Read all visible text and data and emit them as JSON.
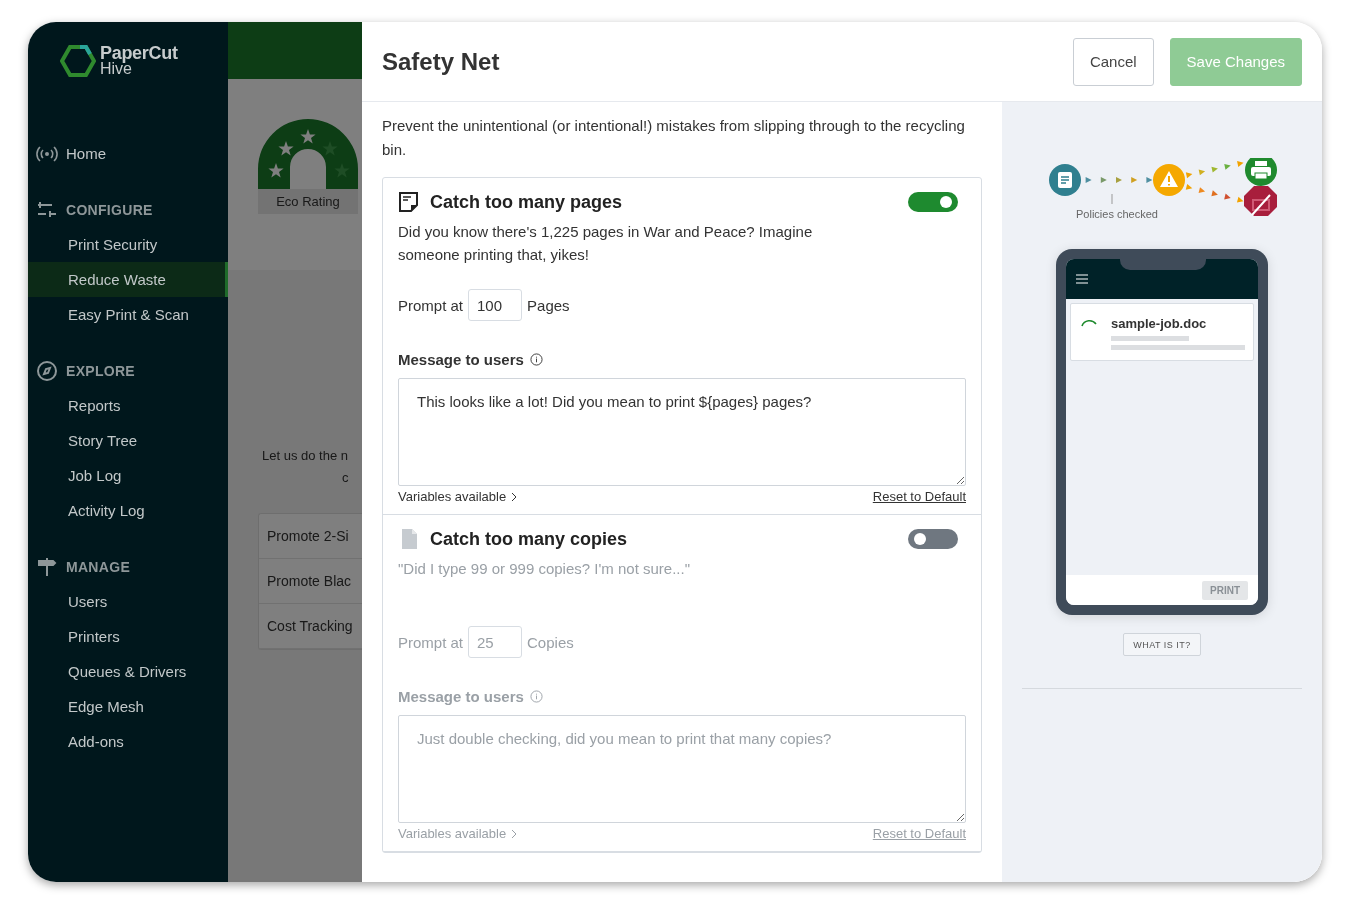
{
  "sidebar": {
    "logo": {
      "brand": "PaperCut",
      "product": "Hive"
    },
    "home": {
      "label": "Home",
      "selected": false
    },
    "sections": [
      {
        "label": "CONFIGURE",
        "items": [
          {
            "label": "Print Security",
            "selected": false
          },
          {
            "label": "Reduce Waste",
            "selected": true
          },
          {
            "label": "Easy Print & Scan",
            "selected": false
          }
        ]
      },
      {
        "label": "EXPLORE",
        "items": [
          {
            "label": "Reports",
            "selected": false
          },
          {
            "label": "Story Tree",
            "selected": false
          },
          {
            "label": "Job Log",
            "selected": false
          },
          {
            "label": "Activity Log",
            "selected": false
          }
        ]
      },
      {
        "label": "MANAGE",
        "items": [
          {
            "label": "Users",
            "selected": false
          },
          {
            "label": "Printers",
            "selected": false
          },
          {
            "label": "Queues & Drivers",
            "selected": false
          },
          {
            "label": "Edge Mesh",
            "selected": false
          },
          {
            "label": "Add-ons",
            "selected": false
          }
        ]
      }
    ]
  },
  "background_page": {
    "badge_label": "Eco Rating",
    "intro_lines": [
      "Let us do the n",
      "c"
    ],
    "list": [
      "Promote 2-Si",
      "Promote Blac",
      "Cost Tracking"
    ]
  },
  "drawer": {
    "title": "Safety Net",
    "buttons": [
      {
        "kind": "secondary",
        "label": "Cancel"
      },
      {
        "kind": "primary",
        "label": "Save Changes",
        "disabled": true
      }
    ],
    "intro": "Prevent the unintentional (or intentional!) mistakes from slipping through to the recycling bin.",
    "policies": [
      {
        "kind": "pages",
        "title": "Catch too many pages",
        "enabled": true,
        "description": "Did you know there's 1,225 pages in War and Peace? Imagine someone printing that, yikes!",
        "prompt_label": "Prompt at",
        "value": "100",
        "unit": "Pages",
        "message_label": "Message to users",
        "message": "This looks like a lot! Did you mean to print ${pages} pages?",
        "variables": "Variables available",
        "reset": "Reset to Default"
      },
      {
        "kind": "copies",
        "title": "Catch too many copies",
        "enabled": false,
        "description": "\"Did I type 99 or 999 copies? I'm not sure...\"",
        "prompt_label": "Prompt at",
        "value": "25",
        "unit": "Copies",
        "message_label": "Message to users",
        "message": "Just double checking, did you mean to print that many copies?",
        "variables": "Variables available",
        "reset": "Reset to Default"
      }
    ]
  },
  "preview": {
    "flow_label": "Policies checked",
    "job_name": "sample-job.doc",
    "print_button": "PRINT",
    "help_button": "WHAT IS IT?"
  }
}
